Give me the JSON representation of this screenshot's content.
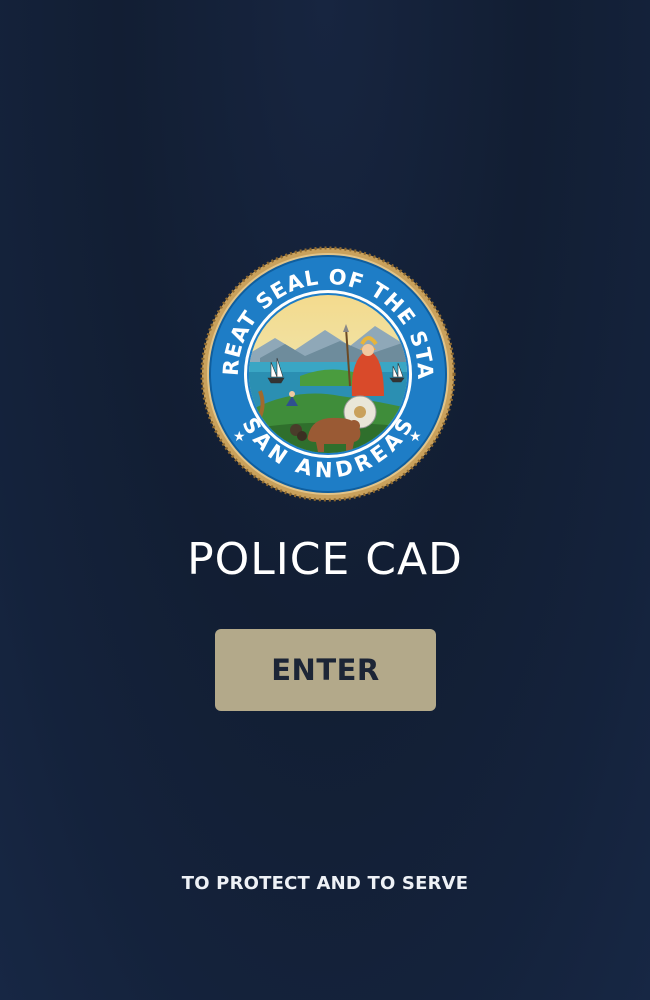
{
  "seal": {
    "top_text": "THE GREAT SEAL OF THE STATE OF",
    "bottom_text": "SAN ANDREAS"
  },
  "title": "POLICE CAD",
  "enter_button": {
    "label": "ENTER"
  },
  "motto": "TO PROTECT AND TO SERVE",
  "colors": {
    "background": "#131f35",
    "button": "#b3a98a",
    "button_text": "#1c2536",
    "seal_ring": "#1e7dc6",
    "seal_rope": "#c9a15c"
  }
}
